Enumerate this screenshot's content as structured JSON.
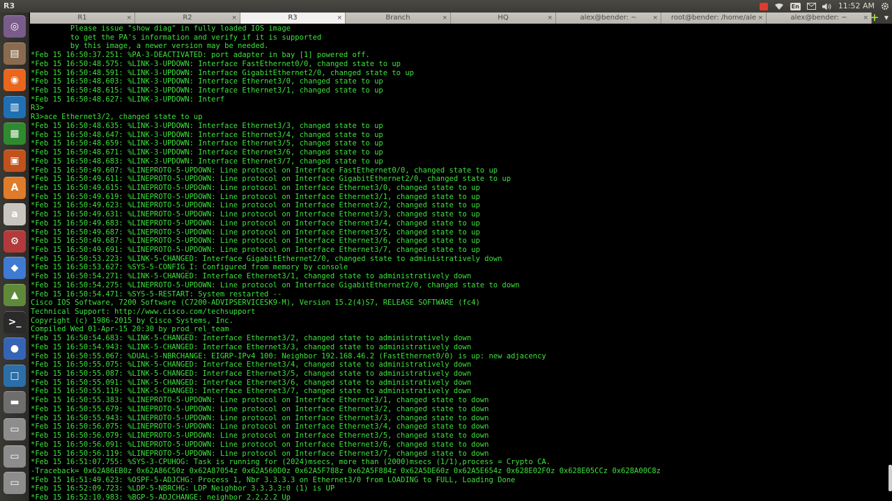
{
  "window": {
    "title": "R3"
  },
  "tray": {
    "language": "En",
    "time": "11:52 AM"
  },
  "launcher": {
    "items": [
      {
        "name": "dash-home-icon",
        "glyph": "◎",
        "bg": "#7a5c8b"
      },
      {
        "name": "files-icon",
        "glyph": "▤",
        "bg": "#8a6b4f"
      },
      {
        "name": "firefox-icon",
        "glyph": "◉",
        "bg": "#e8661d"
      },
      {
        "name": "writer-icon",
        "glyph": "▥",
        "bg": "#1f6fb5"
      },
      {
        "name": "calc-icon",
        "glyph": "▦",
        "bg": "#2f8a2f"
      },
      {
        "name": "impress-icon",
        "glyph": "▣",
        "bg": "#c0521c"
      },
      {
        "name": "software-center-icon",
        "glyph": "A",
        "bg": "#e07b2a"
      },
      {
        "name": "amazon-icon",
        "glyph": "a",
        "bg": "#c9c6bf"
      },
      {
        "name": "system-settings-icon",
        "glyph": "⚙",
        "bg": "#b33a3a"
      },
      {
        "name": "wireshark-icon",
        "glyph": "◆",
        "bg": "#3f7bd1"
      },
      {
        "name": "gns3-icon",
        "glyph": "▲",
        "bg": "#5f8a3a"
      },
      {
        "name": "terminal-icon",
        "glyph": ">_",
        "bg": "#2a2a2a"
      },
      {
        "name": "app-icon-blue",
        "glyph": "●",
        "bg": "#3564b5"
      },
      {
        "name": "virtualbox-icon",
        "glyph": "□",
        "bg": "#2b6ea8"
      },
      {
        "name": "floppy-icon",
        "glyph": "▬",
        "bg": "#6e6e6e"
      },
      {
        "name": "drive-icon-1",
        "glyph": "▭",
        "bg": "#8d8d8d"
      },
      {
        "name": "drive-icon-2",
        "glyph": "▭",
        "bg": "#8d8d8d"
      },
      {
        "name": "drive-icon-3",
        "glyph": "▭",
        "bg": "#8d8d8d"
      }
    ]
  },
  "tabs": [
    {
      "label": "R1",
      "active": false
    },
    {
      "label": "R2",
      "active": false
    },
    {
      "label": "R3",
      "active": true
    },
    {
      "label": "Branch",
      "active": false
    },
    {
      "label": "HQ",
      "active": false
    },
    {
      "label": "alex@bender: ~",
      "active": false
    },
    {
      "label": "root@bender: /home/alex",
      "active": false
    },
    {
      "label": "alex@bender: ~",
      "active": false
    }
  ],
  "tab_close_glyph": "×",
  "new_tab_glyph": "+",
  "tab_menu_glyph": "▼",
  "terminal": {
    "lines": [
      "         Please issue \"show diag\" in fully loaded IOS image",
      "         to get the PA's information and verify if it is supported",
      "         by this image, a newer version may be needed.",
      "*Feb 15 16:50:37.251: %PA-3-DEACTIVATED: port adapter in bay [1] powered off.",
      "*Feb 15 16:50:48.575: %LINK-3-UPDOWN: Interface FastEthernet0/0, changed state to up",
      "*Feb 15 16:50:48.591: %LINK-3-UPDOWN: Interface GigabitEthernet2/0, changed state to up",
      "*Feb 15 16:50:48.603: %LINK-3-UPDOWN: Interface Ethernet3/0, changed state to up",
      "*Feb 15 16:50:48.615: %LINK-3-UPDOWN: Interface Ethernet3/1, changed state to up",
      "*Feb 15 16:50:48.627: %LINK-3-UPDOWN: Interf",
      "R3>",
      "R3>ace Ethernet3/2, changed state to up",
      "*Feb 15 16:50:48.635: %LINK-3-UPDOWN: Interface Ethernet3/3, changed state to up",
      "*Feb 15 16:50:48.647: %LINK-3-UPDOWN: Interface Ethernet3/4, changed state to up",
      "*Feb 15 16:50:48.659: %LINK-3-UPDOWN: Interface Ethernet3/5, changed state to up",
      "*Feb 15 16:50:48.671: %LINK-3-UPDOWN: Interface Ethernet3/6, changed state to up",
      "*Feb 15 16:50:48.683: %LINK-3-UPDOWN: Interface Ethernet3/7, changed state to up",
      "*Feb 15 16:50:49.607: %LINEPROTO-5-UPDOWN: Line protocol on Interface FastEthernet0/0, changed state to up",
      "*Feb 15 16:50:49.611: %LINEPROTO-5-UPDOWN: Line protocol on Interface GigabitEthernet2/0, changed state to up",
      "*Feb 15 16:50:49.615: %LINEPROTO-5-UPDOWN: Line protocol on Interface Ethernet3/0, changed state to up",
      "*Feb 15 16:50:49.619: %LINEPROTO-5-UPDOWN: Line protocol on Interface Ethernet3/1, changed state to up",
      "*Feb 15 16:50:49.623: %LINEPROTO-5-UPDOWN: Line protocol on Interface Ethernet3/2, changed state to up",
      "*Feb 15 16:50:49.631: %LINEPROTO-5-UPDOWN: Line protocol on Interface Ethernet3/3, changed state to up",
      "*Feb 15 16:50:49.683: %LINEPROTO-5-UPDOWN: Line protocol on Interface Ethernet3/4, changed state to up",
      "*Feb 15 16:50:49.687: %LINEPROTO-5-UPDOWN: Line protocol on Interface Ethernet3/5, changed state to up",
      "*Feb 15 16:50:49.687: %LINEPROTO-5-UPDOWN: Line protocol on Interface Ethernet3/6, changed state to up",
      "*Feb 15 16:50:49.691: %LINEPROTO-5-UPDOWN: Line protocol on Interface Ethernet3/7, changed state to up",
      "*Feb 15 16:50:53.223: %LINK-5-CHANGED: Interface GigabitEthernet2/0, changed state to administratively down",
      "*Feb 15 16:50:53.627: %SYS-5-CONFIG_I: Configured from memory by console",
      "*Feb 15 16:50:54.271: %LINK-5-CHANGED: Interface Ethernet3/1, changed state to administratively down",
      "*Feb 15 16:50:54.275: %LINEPROTO-5-UPDOWN: Line protocol on Interface GigabitEthernet2/0, changed state to down",
      "*Feb 15 16:50:54.471: %SYS-5-RESTART: System restarted --",
      "Cisco IOS Software, 7200 Software (C7200-ADVIPSERVICESK9-M), Version 15.2(4)S7, RELEASE SOFTWARE (fc4)",
      "Technical Support: http://www.cisco.com/techsupport",
      "Copyright (c) 1986-2015 by Cisco Systems, Inc.",
      "Compiled Wed 01-Apr-15 20:30 by prod_rel_team",
      "*Feb 15 16:50:54.683: %LINK-5-CHANGED: Interface Ethernet3/2, changed state to administratively down",
      "*Feb 15 16:50:54.943: %LINK-5-CHANGED: Interface Ethernet3/3, changed state to administratively down",
      "*Feb 15 16:50:55.067: %DUAL-5-NBRCHANGE: EIGRP-IPv4 100: Neighbor 192.168.46.2 (FastEthernet0/0) is up: new adjacency",
      "*Feb 15 16:50:55.075: %LINK-5-CHANGED: Interface Ethernet3/4, changed state to administratively down",
      "*Feb 15 16:50:55.087: %LINK-5-CHANGED: Interface Ethernet3/5, changed state to administratively down",
      "*Feb 15 16:50:55.091: %LINK-5-CHANGED: Interface Ethernet3/6, changed state to administratively down",
      "*Feb 15 16:50:55.119: %LINK-5-CHANGED: Interface Ethernet3/7, changed state to administratively down",
      "*Feb 15 16:50:55.383: %LINEPROTO-5-UPDOWN: Line protocol on Interface Ethernet3/1, changed state to down",
      "*Feb 15 16:50:55.679: %LINEPROTO-5-UPDOWN: Line protocol on Interface Ethernet3/2, changed state to down",
      "*Feb 15 16:50:55.943: %LINEPROTO-5-UPDOWN: Line protocol on Interface Ethernet3/3, changed state to down",
      "*Feb 15 16:50:56.075: %LINEPROTO-5-UPDOWN: Line protocol on Interface Ethernet3/4, changed state to down",
      "*Feb 15 16:50:56.079: %LINEPROTO-5-UPDOWN: Line protocol on Interface Ethernet3/5, changed state to down",
      "*Feb 15 16:50:56.091: %LINEPROTO-5-UPDOWN: Line protocol on Interface Ethernet3/6, changed state to down",
      "*Feb 15 16:50:56.119: %LINEPROTO-5-UPDOWN: Line protocol on Interface Ethernet3/7, changed state to down",
      "*Feb 15 16:51:07.755: %SYS-3-CPUHOG: Task is running for (2024)msecs, more than (2000)msecs (1/1),process = Crypto CA.",
      "-Traceback= 0x62A86EB0z 0x62A86C50z 0x62A87054z 0x62A560D0z 0x62A5F788z 0x62A5F884z 0x62A5DE60z 0x62A5E654z 0x628E02F0z 0x628E05CCz 0x628A00C8z",
      "*Feb 15 16:51:49.623: %OSPF-5-ADJCHG: Process 1, Nbr 3.3.3.3 on Ethernet3/0 from LOADING to FULL, Loading Done",
      "*Feb 15 16:52:09.723: %LDP-5-NBRCHG: LDP Neighbor 3.3.3.3:0 (1) is UP",
      "*Feb 15 16:52:10.983: %BGP-5-ADJCHANGE: neighbor 2.2.2.2 Up"
    ]
  }
}
